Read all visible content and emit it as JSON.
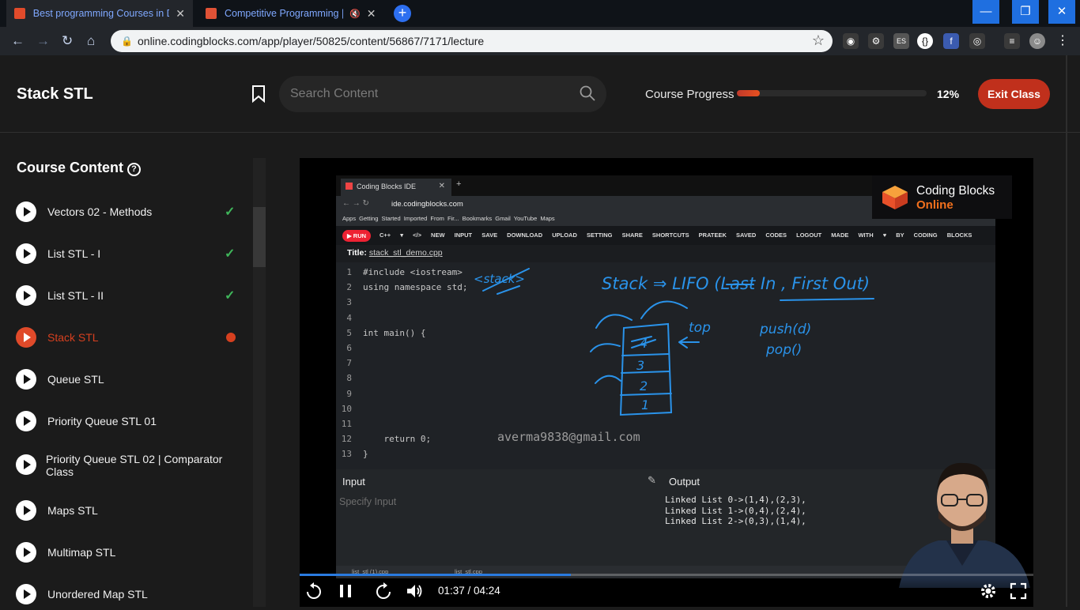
{
  "browser": {
    "tabs": [
      {
        "title": "Best programming Courses in De",
        "active": true
      },
      {
        "title": "Competitive Programming |",
        "active": false
      }
    ],
    "url": "online.codingblocks.com/app/player/50825/content/56867/7171/lecture"
  },
  "header": {
    "title": "Stack STL",
    "search_placeholder": "Search Content",
    "progress_label": "Course Progress",
    "progress_value": 0.12,
    "progress_text": "12%",
    "exit_label": "Exit Class"
  },
  "sidebar": {
    "title": "Course Content",
    "help_glyph": "?",
    "lectures": [
      {
        "label": "Vectors 02 - Methods",
        "status": "done"
      },
      {
        "label": "List STL - I",
        "status": "done"
      },
      {
        "label": "List STL - II",
        "status": "done"
      },
      {
        "label": "Stack STL",
        "status": "current"
      },
      {
        "label": "Queue STL",
        "status": "todo"
      },
      {
        "label": "Priority Queue STL 01",
        "status": "todo"
      },
      {
        "label": "Priority Queue STL 02 | Comparator Class",
        "status": "todo"
      },
      {
        "label": "Maps STL",
        "status": "todo"
      },
      {
        "label": "Multimap STL",
        "status": "todo"
      },
      {
        "label": "Unordered Map STL",
        "status": "todo"
      }
    ]
  },
  "video": {
    "ide": {
      "tab_title": "Coding Blocks IDE",
      "address": "ide.codingblocks.com",
      "bookmarks": "Apps   Getting Started   Imported From Fir...   Bookmarks   Gmail   YouTube   Maps",
      "run_label": "RUN",
      "menu_items": "C++ ▾ </>  NEW  INPUT  SAVE  DOWNLOAD  UPLOAD  SETTING  SHARE  SHORTCUTS  PRATEEK  SAVED CODES  LOGOUT  MADE WITH ♥ BY CODING BLOCKS",
      "title_label": "Title:",
      "file_name": "stack_stl_demo.cpp",
      "code_lines": [
        {
          "n": "1",
          "t": "#include <iostream>"
        },
        {
          "n": "2",
          "t": "using namespace std;"
        },
        {
          "n": "3",
          "t": ""
        },
        {
          "n": "4",
          "t": ""
        },
        {
          "n": "5",
          "t": "int main() {"
        },
        {
          "n": "6",
          "t": ""
        },
        {
          "n": "7",
          "t": ""
        },
        {
          "n": "8",
          "t": ""
        },
        {
          "n": "9",
          "t": ""
        },
        {
          "n": "10",
          "t": ""
        },
        {
          "n": "11",
          "t": ""
        },
        {
          "n": "12",
          "t": "    return 0;"
        },
        {
          "n": "13",
          "t": "}"
        }
      ],
      "watermark": "averma9838@gmail.com",
      "input_label": "Input",
      "input_placeholder": "Specify Input",
      "output_label": "Output",
      "output_text": "Linked List 0->(1,4),(2,3),\nLinked List 1->(0,4),(2,4),\nLinked List 2->(0,3),(1,4),",
      "download_files": [
        "list_stl (1).cpp",
        "list_stl.cpp"
      ]
    },
    "logo": {
      "line1": "Coding Blocks",
      "line2": "Online"
    },
    "annotations": {
      "stack_tag": "<stack>",
      "heading": "Stack  ⇒  LIFO   (Last In , First Out)",
      "top": "top",
      "push": "push(d)",
      "pop": "pop()",
      "cells": [
        "1",
        "2",
        "3",
        "4"
      ]
    },
    "time_text": "01:37 / 04:24",
    "progress_value": 0.37
  }
}
